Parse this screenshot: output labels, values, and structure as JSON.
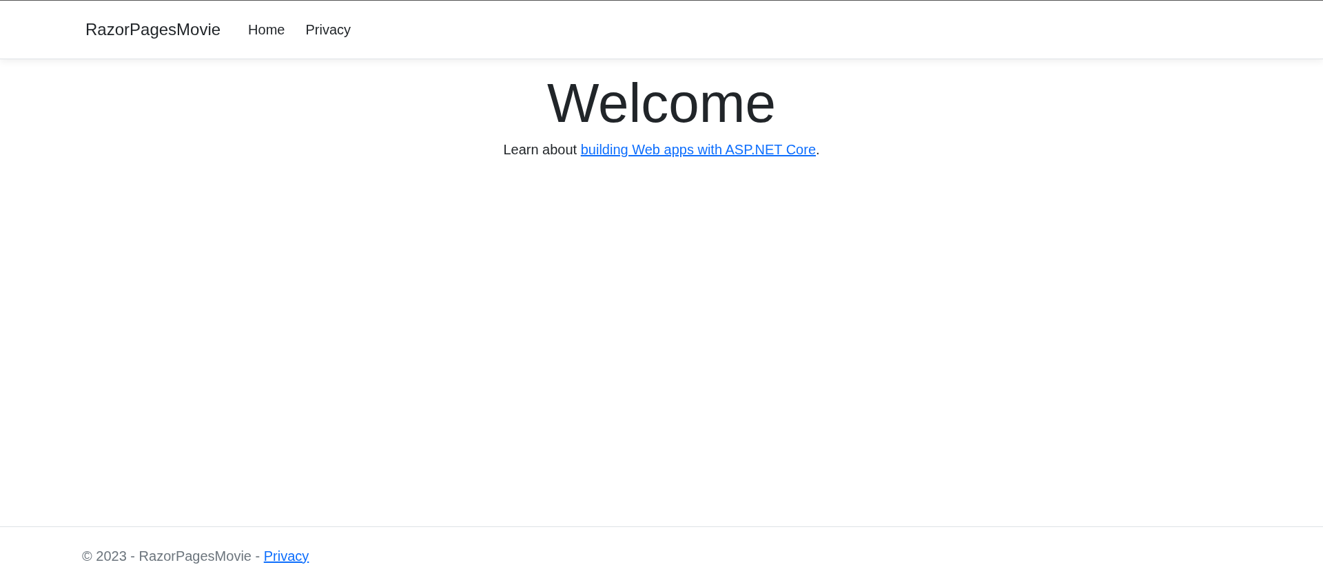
{
  "navbar": {
    "brand": "RazorPagesMovie",
    "links": [
      {
        "label": "Home"
      },
      {
        "label": "Privacy"
      }
    ]
  },
  "main": {
    "heading": "Welcome",
    "text_before": "Learn about ",
    "link": "building Web apps with ASP.NET Core",
    "text_after": "."
  },
  "footer": {
    "text": "© 2023 - RazorPagesMovie - ",
    "link": "Privacy"
  }
}
